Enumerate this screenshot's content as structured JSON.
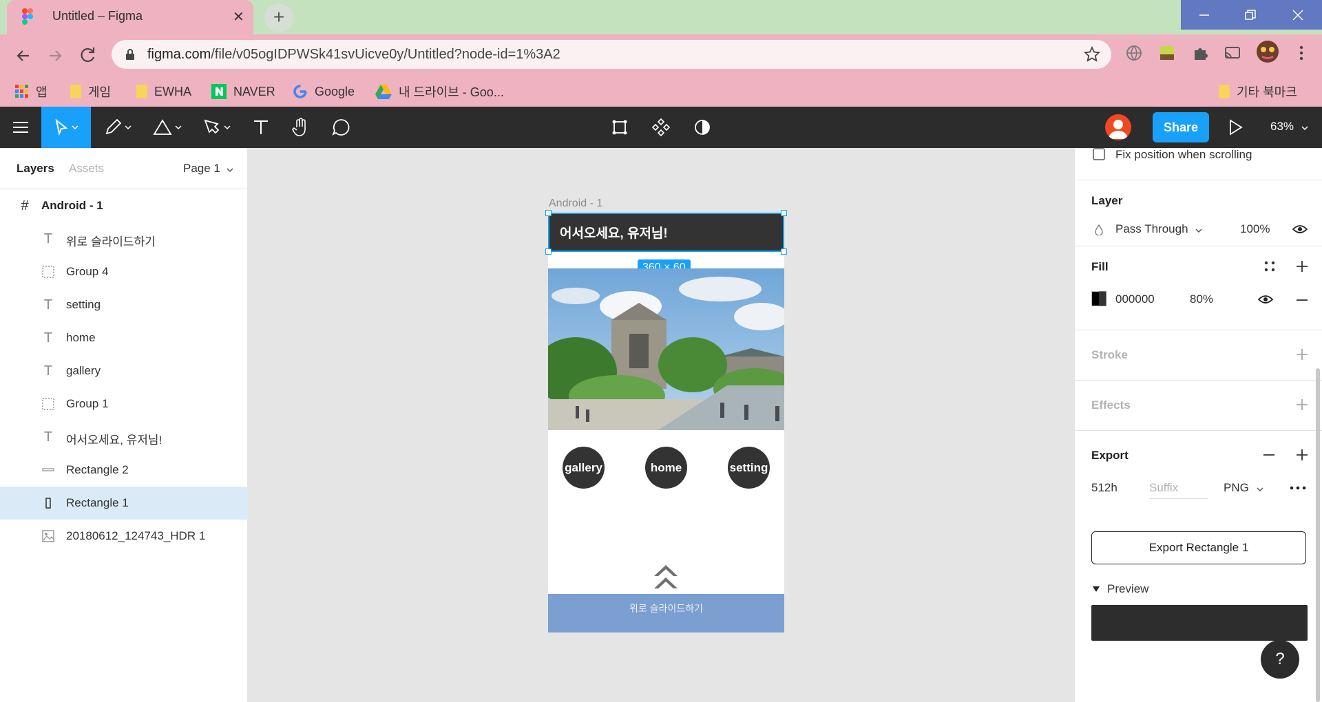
{
  "browser": {
    "tab_title": "Untitled – Figma",
    "new_tab": "+",
    "url_host": "figma.com",
    "url_path": "/file/v05ogIDPWSk41svUicve0y/Untitled?node-id=1%3A2",
    "bookmarks": [
      {
        "label": "앱",
        "icon": "apps-grid-icon"
      },
      {
        "label": "게임",
        "icon": "folder-icon"
      },
      {
        "label": "EWHA",
        "icon": "folder-icon"
      },
      {
        "label": "NAVER",
        "icon": "naver-icon"
      },
      {
        "label": "Google",
        "icon": "google-icon"
      },
      {
        "label": "내 드라이브 - Goo...",
        "icon": "drive-icon"
      }
    ],
    "other_bookmarks": "기타 북마크"
  },
  "figma_toolbar": {
    "share_label": "Share",
    "zoom": "63%"
  },
  "left_panel": {
    "tab_layers": "Layers",
    "tab_assets": "Assets",
    "page": "Page 1",
    "layers": [
      {
        "name": "Android - 1",
        "type": "frame"
      },
      {
        "name": "위로 슬라이드하기",
        "type": "text"
      },
      {
        "name": "Group 4",
        "type": "group"
      },
      {
        "name": "setting",
        "type": "text"
      },
      {
        "name": "home",
        "type": "text"
      },
      {
        "name": "gallery",
        "type": "text"
      },
      {
        "name": "Group 1",
        "type": "group"
      },
      {
        "name": "어서오세요, 유저님!",
        "type": "text"
      },
      {
        "name": "Rectangle 2",
        "type": "line"
      },
      {
        "name": "Rectangle 1",
        "type": "rect",
        "selected": true
      },
      {
        "name": "20180612_124743_HDR 1",
        "type": "image"
      }
    ]
  },
  "canvas": {
    "frame_label": "Android - 1",
    "greeting": "어서오세요, 유저님!",
    "dims": "360 × 60",
    "buttons": {
      "gallery": "gallery",
      "home": "home",
      "setting": "setting"
    },
    "slide_up": "위로 슬라이드하기"
  },
  "right_panel": {
    "fix_position": "Fix position when scrolling",
    "layer_title": "Layer",
    "blend_mode": "Pass Through",
    "opacity": "100%",
    "fill_title": "Fill",
    "fill_hex": "000000",
    "fill_opacity": "80%",
    "stroke_title": "Stroke",
    "effects_title": "Effects",
    "export_title": "Export",
    "export_size": "512h",
    "suffix_placeholder": "Suffix",
    "format": "PNG",
    "export_button": "Export Rectangle 1",
    "preview": "Preview",
    "help": "?"
  },
  "colors": {
    "tabstrip": "#c5e2bf",
    "chrome": "#eeb2c1",
    "figma_dark": "#2c2c2c",
    "figma_blue": "#18a0fb",
    "slide_bar": "#7b9fd0"
  }
}
